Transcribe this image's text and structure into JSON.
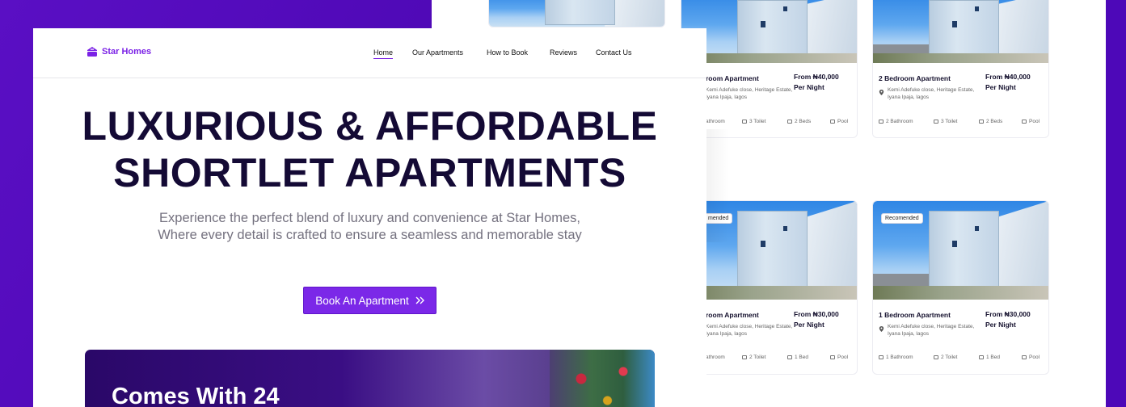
{
  "brand": {
    "name": "Star Homes",
    "accent": "#7B22E6",
    "bg_purple": "#4D08B8"
  },
  "nav": {
    "items": [
      {
        "label": "Home",
        "active": true
      },
      {
        "label": "Our Apartments",
        "active": false
      },
      {
        "label": "How to Book",
        "active": false
      },
      {
        "label": "Reviews",
        "active": false
      },
      {
        "label": "Contact Us",
        "active": false
      }
    ]
  },
  "hero": {
    "title_line1": "LUXURIOUS & AFFORDABLE",
    "title_line2": "SHORTLET APARTMENTS",
    "subtitle": "Experience the perfect blend of luxury and convenience at Star Homes, Where every detail is crafted to ensure a seamless and memorable stay",
    "cta_label": "Book An Apartment",
    "cta_icon": "chevrons-right-icon"
  },
  "feature": {
    "title": "Comes With 24"
  },
  "cards": [
    {
      "badge": "",
      "title": "room Apartment",
      "price": "From ₦40,000",
      "per": "Per Night",
      "addr": "Kemi Adefuke close, Heritage Estate, Iyana Ipaja, lagos",
      "bath": "athroom",
      "toilet": "3 Toilet",
      "beds": "2 Beds",
      "pool": "Pool"
    },
    {
      "badge": "",
      "title": "2 Bedroom Apartment",
      "price": "From ₦40,000",
      "per": "Per Night",
      "addr": "Kemi Adefuke close, Heritage Estate, Iyana Ipaja, lagos",
      "bath": "2 Bathroom",
      "toilet": "3 Toilet",
      "beds": "2 Beds",
      "pool": "Pool"
    },
    {
      "badge": "mended",
      "title": "room Apartment",
      "price": "From ₦30,000",
      "per": "Per Night",
      "addr": "Kemi Adefuke close, Heritage Estate, Iyana Ipaja, lagos",
      "bath": "athroom",
      "toilet": "2 Toilet",
      "beds": "1 Bed",
      "pool": "Pool"
    },
    {
      "badge": "Recomended",
      "title": "1 Bedroom Apartment",
      "price": "From ₦30,000",
      "per": "Per Night",
      "addr": "Kemi Adefuke close, Heritage Estate, Iyana Ipaja, lagos",
      "bath": "1 Bathroom",
      "toilet": "2 Toilet",
      "beds": "1 Bed",
      "pool": "Pool"
    }
  ]
}
